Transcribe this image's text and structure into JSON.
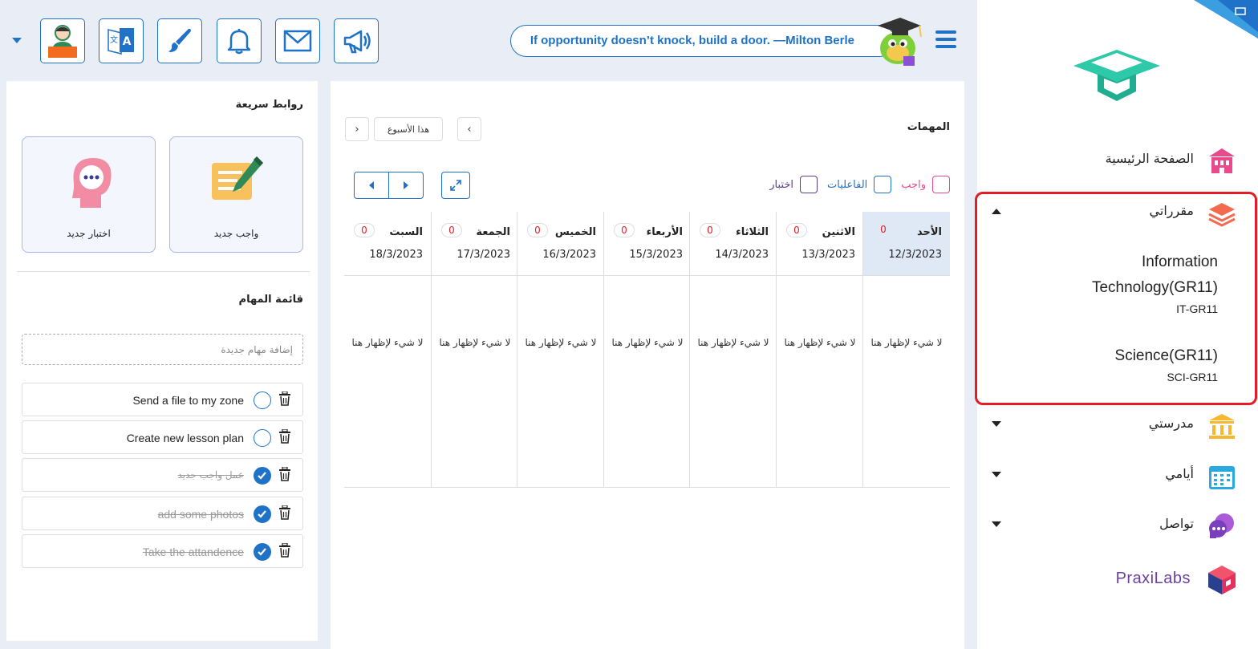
{
  "header": {
    "quote": "If opportunity doesn’t knock, build a door. —Milton Berle",
    "tools": [
      "profile-icon",
      "translate-icon",
      "brush-icon",
      "bell-icon",
      "mail-icon",
      "megaphone-icon"
    ]
  },
  "sidebar": {
    "home": "الصفحة الرئيسية",
    "courses": "مقرراتي",
    "course_list": [
      {
        "name_line1": "Information",
        "name_line2": "Technology(GR11)",
        "code": "IT-GR11"
      },
      {
        "name_line1": "Science(GR11)",
        "code": "SCI-GR11"
      }
    ],
    "school": "مدرستي",
    "days": "أيامي",
    "communication": "تواصل",
    "brand": "PraxiLabs"
  },
  "tasks": {
    "title": "المهمات",
    "week_label": "هذا الأسبوع",
    "legend": {
      "homework": "واجب",
      "activities": "الفاعليات",
      "exam": "اختبار"
    },
    "empty_text": "لا شيء لإظهار هنا",
    "days": [
      {
        "name": "الأحد",
        "date": "12/3/2023",
        "count": "0"
      },
      {
        "name": "الاثنين",
        "date": "13/3/2023",
        "count": "0"
      },
      {
        "name": "الثلاثاء",
        "date": "14/3/2023",
        "count": "0"
      },
      {
        "name": "الأربعاء",
        "date": "15/3/2023",
        "count": "0"
      },
      {
        "name": "الخميس",
        "date": "16/3/2023",
        "count": "0"
      },
      {
        "name": "الجمعة",
        "date": "17/3/2023",
        "count": "0"
      },
      {
        "name": "السبت",
        "date": "18/3/2023",
        "count": "0"
      }
    ]
  },
  "quick_links": {
    "title": "روابط سريعة",
    "new_homework": "واجب جديد",
    "new_exam": "اختبار جديد"
  },
  "todo": {
    "title": "قائمة المهام",
    "placeholder": "إضافة مهام جديدة",
    "items": [
      {
        "text": "Send a file to my zone",
        "done": false
      },
      {
        "text": "Create new lesson plan",
        "done": false
      },
      {
        "text": "عمل واجب جديد",
        "done": true
      },
      {
        "text": "add some photos",
        "done": true
      },
      {
        "text": "Take the attandence",
        "done": true
      }
    ]
  },
  "colors": {
    "primary": "#1f72c7",
    "highlight": "#e31c25",
    "homework": "#e84a8c",
    "activities": "#1f72c7",
    "exam": "#5a3d8f"
  }
}
